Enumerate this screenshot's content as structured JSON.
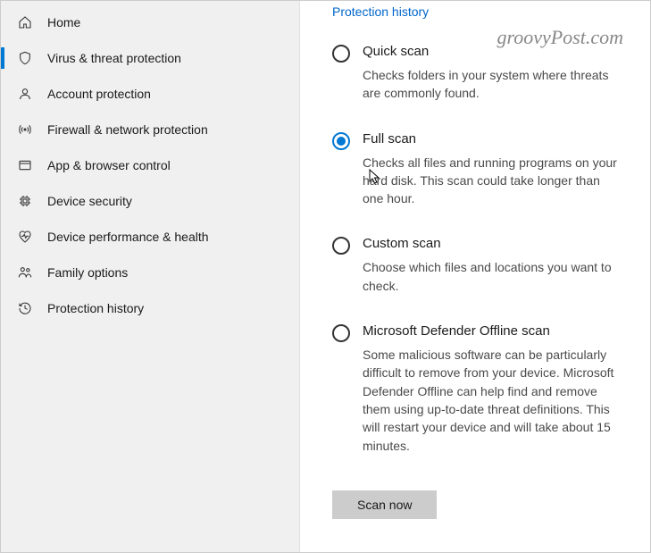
{
  "sidebar": {
    "items": [
      {
        "label": "Home"
      },
      {
        "label": "Virus & threat protection"
      },
      {
        "label": "Account protection"
      },
      {
        "label": "Firewall & network protection"
      },
      {
        "label": "App & browser control"
      },
      {
        "label": "Device security"
      },
      {
        "label": "Device performance & health"
      },
      {
        "label": "Family options"
      },
      {
        "label": "Protection history"
      }
    ]
  },
  "content": {
    "historyLink": "Protection history",
    "scanButton": "Scan now"
  },
  "watermark": "groovyPost.com",
  "scanOptions": [
    {
      "title": "Quick scan",
      "desc": "Checks folders in your system where threats are commonly found.",
      "checked": false
    },
    {
      "title": "Full scan",
      "desc": "Checks all files and running programs on your hard disk. This scan could take longer than one hour.",
      "checked": true
    },
    {
      "title": "Custom scan",
      "desc": "Choose which files and locations you want to check.",
      "checked": false
    },
    {
      "title": "Microsoft Defender Offline scan",
      "desc": "Some malicious software can be particularly difficult to remove from your device. Microsoft Defender Offline can help find and remove them using up-to-date threat definitions. This will restart your device and will take about 15 minutes.",
      "checked": false
    }
  ]
}
